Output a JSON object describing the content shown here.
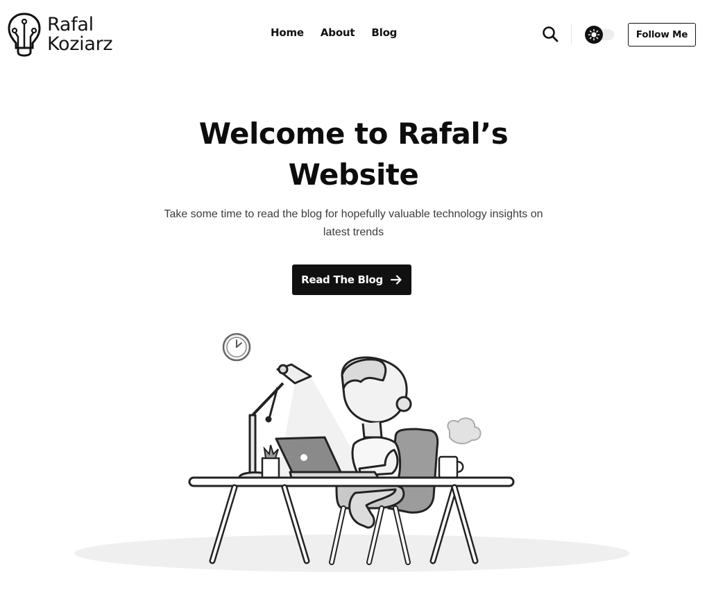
{
  "brand": {
    "line1": "Rafal",
    "line2": "Koziarz",
    "logo_icon": "lightbulb-circuit-icon"
  },
  "nav": {
    "items": [
      {
        "label": "Home"
      },
      {
        "label": "About"
      },
      {
        "label": "Blog"
      }
    ]
  },
  "header_actions": {
    "search_icon": "search-icon",
    "theme_toggle_icon": "sun-icon",
    "follow_label": "Follow Me"
  },
  "hero": {
    "title": "Welcome to Rafal’s Website",
    "subtitle": "Take some time to read the blog for hopefully valuable technology insights on latest trends",
    "cta_label": "Read The Blog",
    "cta_icon": "arrow-right-icon"
  },
  "colors": {
    "text": "#111111",
    "button_bg": "#111111",
    "button_text": "#ffffff",
    "subtitle": "#3c3c3c"
  }
}
